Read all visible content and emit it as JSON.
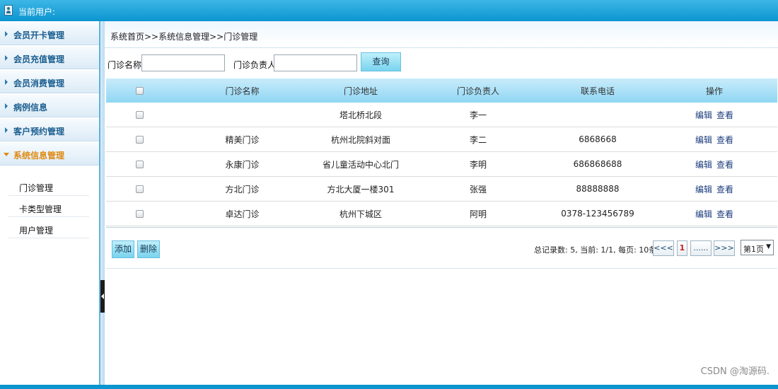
{
  "topbar": {
    "user_label": "当前用户:"
  },
  "sidebar": {
    "menus": [
      {
        "label": "会员开卡管理"
      },
      {
        "label": "会员充值管理"
      },
      {
        "label": "会员消费管理"
      },
      {
        "label": "病例信息"
      },
      {
        "label": "客户预约管理"
      },
      {
        "label": "系统信息管理"
      }
    ],
    "sub_items": [
      {
        "label": "门诊管理"
      },
      {
        "label": "卡类型管理"
      },
      {
        "label": "用户管理"
      }
    ]
  },
  "breadcrumb": "系统首页>>系统信息管理>>门诊管理",
  "search": {
    "name_label": "门诊名称:",
    "name_value": "",
    "owner_label": "门诊负责人:",
    "owner_value": "",
    "query_label": "查询"
  },
  "table": {
    "headers": [
      "门诊名称",
      "门诊地址",
      "门诊负责人",
      "联系电话",
      "操作"
    ],
    "rows": [
      {
        "name": "",
        "address": "塔北桥北段",
        "owner": "李一",
        "phone": ""
      },
      {
        "name": "精美门诊",
        "address": "杭州北院斜对面",
        "owner": "李二",
        "phone": "6868668"
      },
      {
        "name": "永康门诊",
        "address": "省儿童活动中心北门",
        "owner": "李明",
        "phone": "686868688"
      },
      {
        "name": "方北门诊",
        "address": "方北大厦一楼301",
        "owner": "张强",
        "phone": "88888888"
      },
      {
        "name": "卓达门诊",
        "address": "杭州下城区",
        "owner": "阿明",
        "phone": "0378-123456789"
      }
    ],
    "edit_label": "编辑",
    "view_label": "查看"
  },
  "footer": {
    "add_label": "添加",
    "delete_label": "删除",
    "pager_info": "总记录数: 5, 当前: 1/1, 每页: 10条",
    "first": "<<<",
    "current": "1",
    "ellipsis": "......",
    "last": ">>>",
    "page_select": "第1页"
  },
  "watermark": "CSDN @淘源码."
}
